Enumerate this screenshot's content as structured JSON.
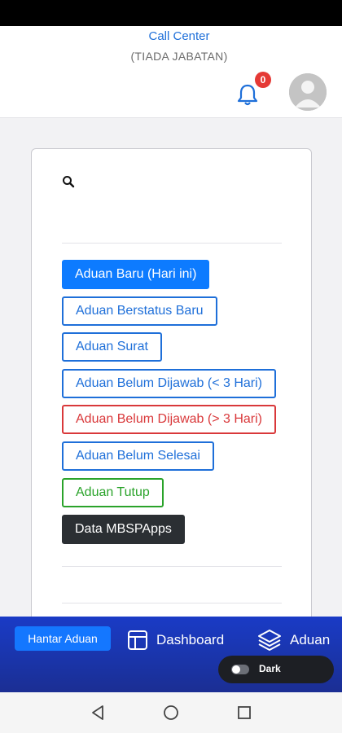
{
  "header": {
    "title": "Call Center",
    "subtitle": "(TIADA JABATAN)",
    "notification_count": "0"
  },
  "card": {
    "buttons": [
      {
        "label": "Aduan Baru (Hari ini)",
        "style": "primary"
      },
      {
        "label": "Aduan Berstatus Baru",
        "style": "outline-blue"
      },
      {
        "label": "Aduan Surat",
        "style": "outline-blue"
      },
      {
        "label": "Aduan Belum Dijawab (< 3 Hari)",
        "style": "outline-blue"
      },
      {
        "label": "Aduan Belum Dijawab (> 3 Hari)",
        "style": "outline-red"
      },
      {
        "label": "Aduan Belum Selesai",
        "style": "outline-blue"
      },
      {
        "label": "Aduan Tutup",
        "style": "outline-green"
      },
      {
        "label": "Data MBSPApps",
        "style": "dark"
      }
    ]
  },
  "bottom_nav": {
    "send_button": "Hantar Aduan",
    "dashboard": "Dashboard",
    "aduan": "Aduan",
    "theme_toggle_label": "Dark",
    "theme_toggle_on": false
  },
  "icons": {
    "bell": "bell-icon",
    "avatar": "user-avatar-icon",
    "search": "search-icon",
    "dashboard": "dashboard-icon",
    "aduan": "layers-icon",
    "back": "back-triangle-icon",
    "home": "home-circle-icon",
    "recents": "recents-square-icon"
  },
  "colors": {
    "primary": "#0d7bff",
    "outline_blue": "#1e6fd9",
    "outline_red": "#d9383a",
    "outline_green": "#2aa32a",
    "dark_button": "#2b2f33",
    "nav_background": "#1a34a8",
    "badge": "#e53935"
  }
}
